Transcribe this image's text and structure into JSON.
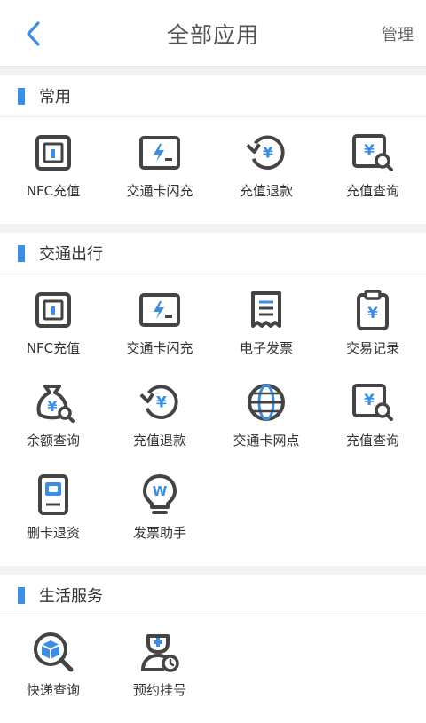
{
  "header": {
    "title": "全部应用",
    "manage_label": "管理"
  },
  "colors": {
    "accent": "#3a8ee6",
    "icon_stroke": "#444444"
  },
  "sections": [
    {
      "title": "常用",
      "apps": [
        {
          "label": "NFC充值",
          "icon": "nfc-icon"
        },
        {
          "label": "交通卡闪充",
          "icon": "flash-card-icon"
        },
        {
          "label": "充值退款",
          "icon": "refund-icon"
        },
        {
          "label": "充值查询",
          "icon": "recharge-query-icon"
        }
      ]
    },
    {
      "title": "交通出行",
      "apps": [
        {
          "label": "NFC充值",
          "icon": "nfc-icon"
        },
        {
          "label": "交通卡闪充",
          "icon": "flash-card-icon"
        },
        {
          "label": "电子发票",
          "icon": "receipt-icon"
        },
        {
          "label": "交易记录",
          "icon": "clipboard-yen-icon"
        },
        {
          "label": "余额查询",
          "icon": "money-bag-icon"
        },
        {
          "label": "充值退款",
          "icon": "refund-icon"
        },
        {
          "label": "交通卡网点",
          "icon": "globe-icon"
        },
        {
          "label": "充值查询",
          "icon": "recharge-query-icon"
        },
        {
          "label": "删卡退资",
          "icon": "card-device-icon"
        },
        {
          "label": "发票助手",
          "icon": "lightbulb-icon"
        }
      ]
    },
    {
      "title": "生活服务",
      "apps": [
        {
          "label": "快递查询",
          "icon": "package-search-icon"
        },
        {
          "label": "预约挂号",
          "icon": "doctor-clock-icon"
        }
      ]
    }
  ]
}
